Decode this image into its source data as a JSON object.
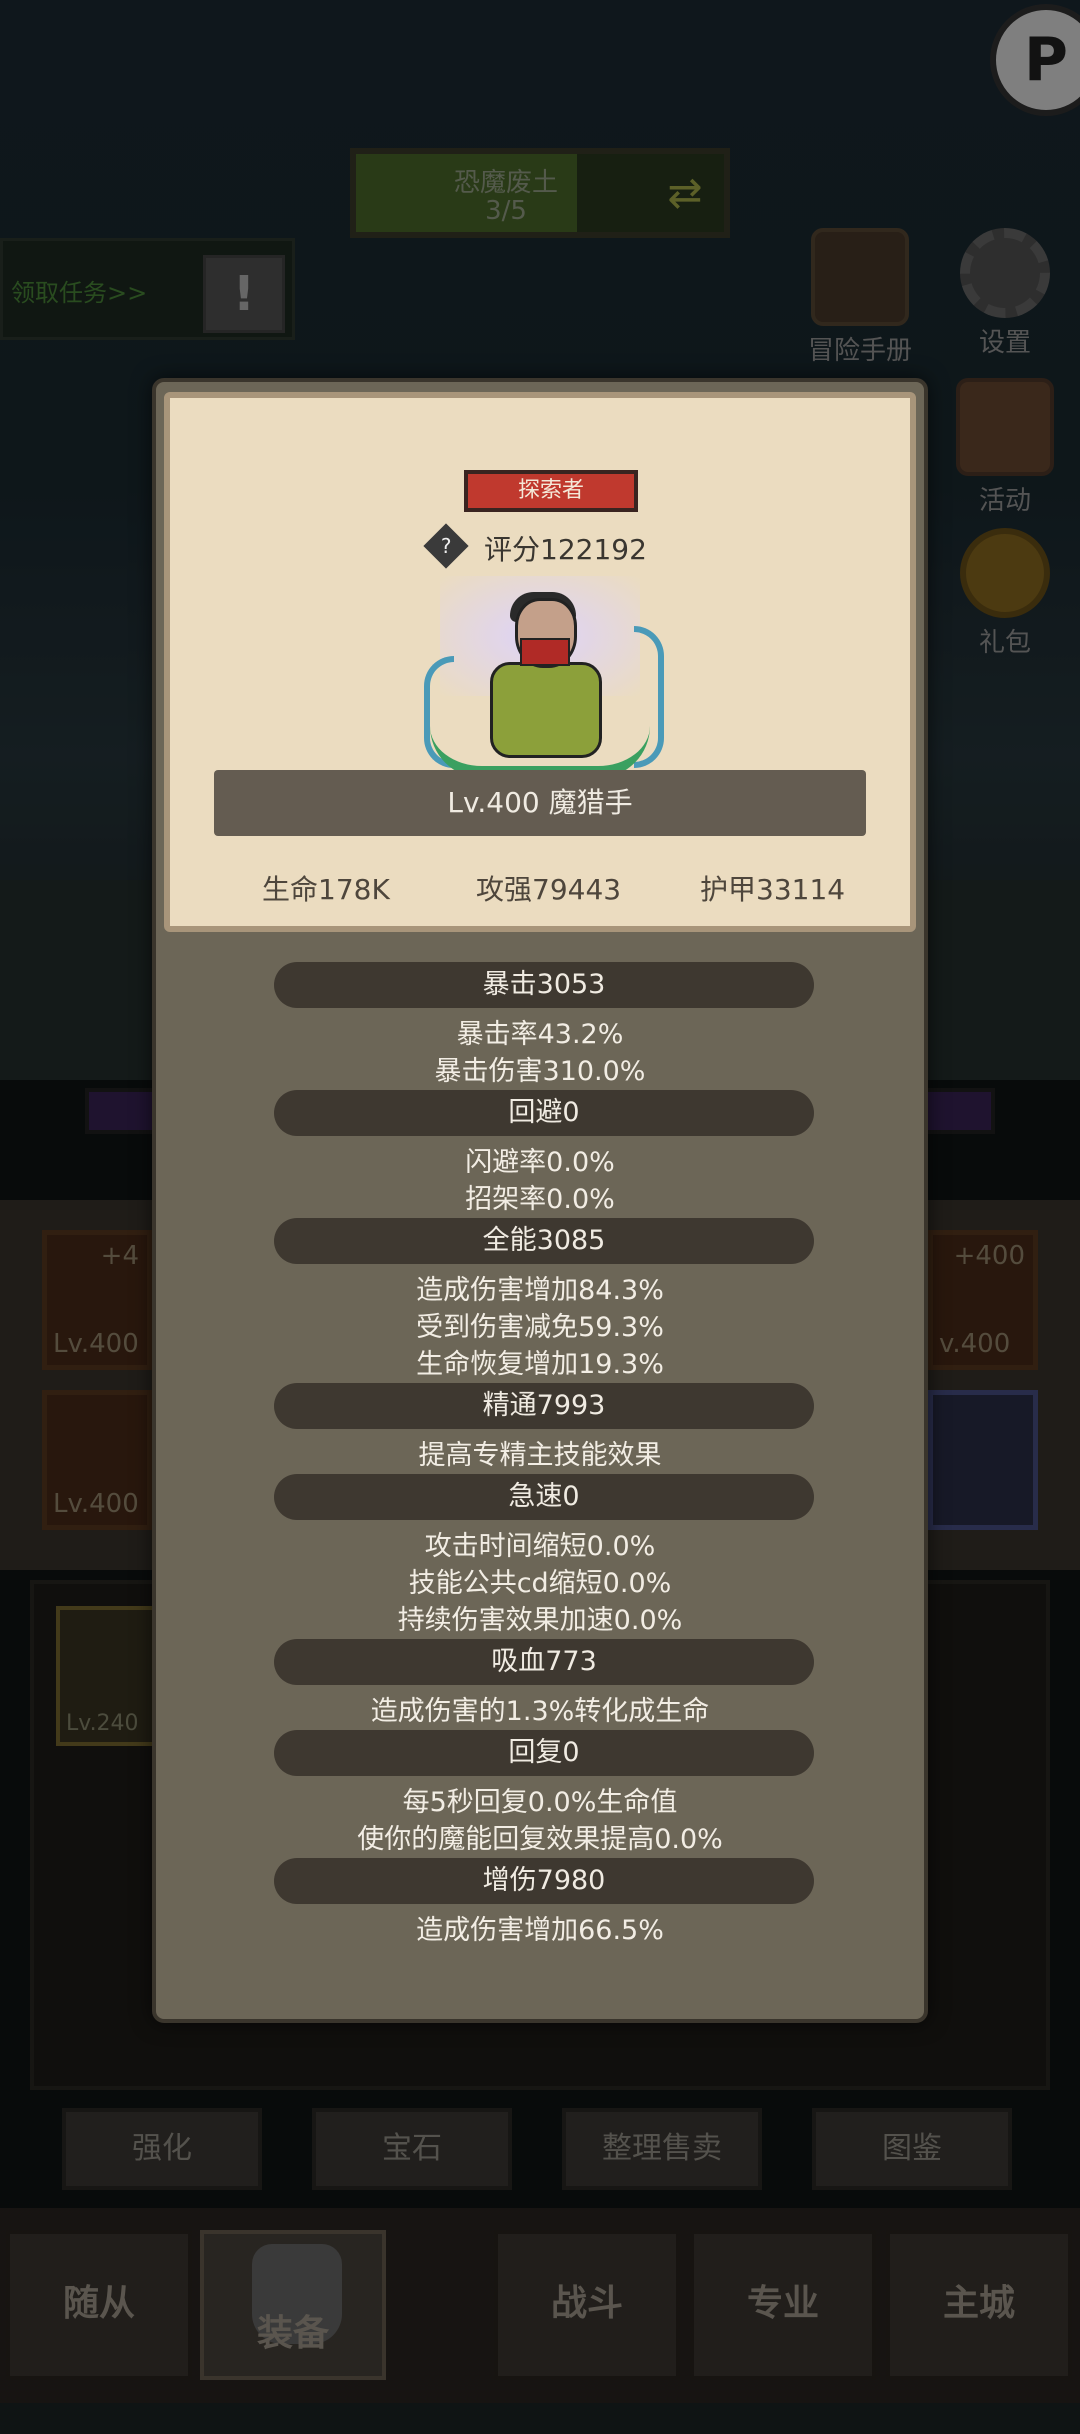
{
  "zone": {
    "name": "恐魔废土",
    "progress": "3/5",
    "progress_fraction": 0.6
  },
  "task": {
    "label": "领取任务>>"
  },
  "side_menu": [
    {
      "label": "冒险手册",
      "icon": "book-icon"
    },
    {
      "label": "设置",
      "icon": "gear-icon"
    },
    {
      "label": "活动",
      "icon": "scroll-icon"
    },
    {
      "label": "礼包",
      "icon": "gift-icon"
    }
  ],
  "equipment_slots": [
    {
      "level": "Lv.400",
      "plus": "+4"
    },
    {
      "level": "Lv.400",
      "plus": ""
    },
    {
      "level": "v.400",
      "plus": "+400"
    },
    {
      "level": "",
      "plus": ""
    }
  ],
  "bag_item": {
    "level": "Lv.240"
  },
  "actions": [
    "强化",
    "宝石",
    "整理售卖",
    "图鉴"
  ],
  "nav": [
    "随从",
    "装备",
    "战斗",
    "专业",
    "主城"
  ],
  "hero": {
    "title_badge": "探索者",
    "score": "评分122192",
    "name": "Lv.400 魔猎手",
    "hp": "生命178K",
    "attack": "攻强79443",
    "armor": "护甲33114"
  },
  "stats": [
    {
      "header": "暴击3053",
      "lines": [
        "暴击率43.2%",
        "暴击伤害310.0%"
      ]
    },
    {
      "header": "回避0",
      "lines": [
        "闪避率0.0%",
        "招架率0.0%"
      ]
    },
    {
      "header": "全能3085",
      "lines": [
        "造成伤害增加84.3%",
        "受到伤害减免59.3%",
        "生命恢复增加19.3%"
      ]
    },
    {
      "header": "精通7993",
      "lines": [
        "提高专精主技能效果"
      ]
    },
    {
      "header": "急速0",
      "lines": [
        "攻击时间缩短0.0%",
        "技能公共cd缩短0.0%",
        "持续伤害效果加速0.0%"
      ]
    },
    {
      "header": "吸血773",
      "lines": [
        "造成伤害的1.3%转化成生命"
      ]
    },
    {
      "header": "回复0",
      "lines": [
        "每5秒回复0.0%生命值",
        "使你的魔能回复效果提高0.0%"
      ]
    },
    {
      "header": "增伤7980",
      "lines": [
        "造成伤害增加66.5%"
      ]
    }
  ],
  "colors": {
    "badge_red": "#c0392e",
    "card_bg": "#ebdcc0",
    "panel_bg": "#6c6657",
    "header_bg": "#3e3830"
  }
}
